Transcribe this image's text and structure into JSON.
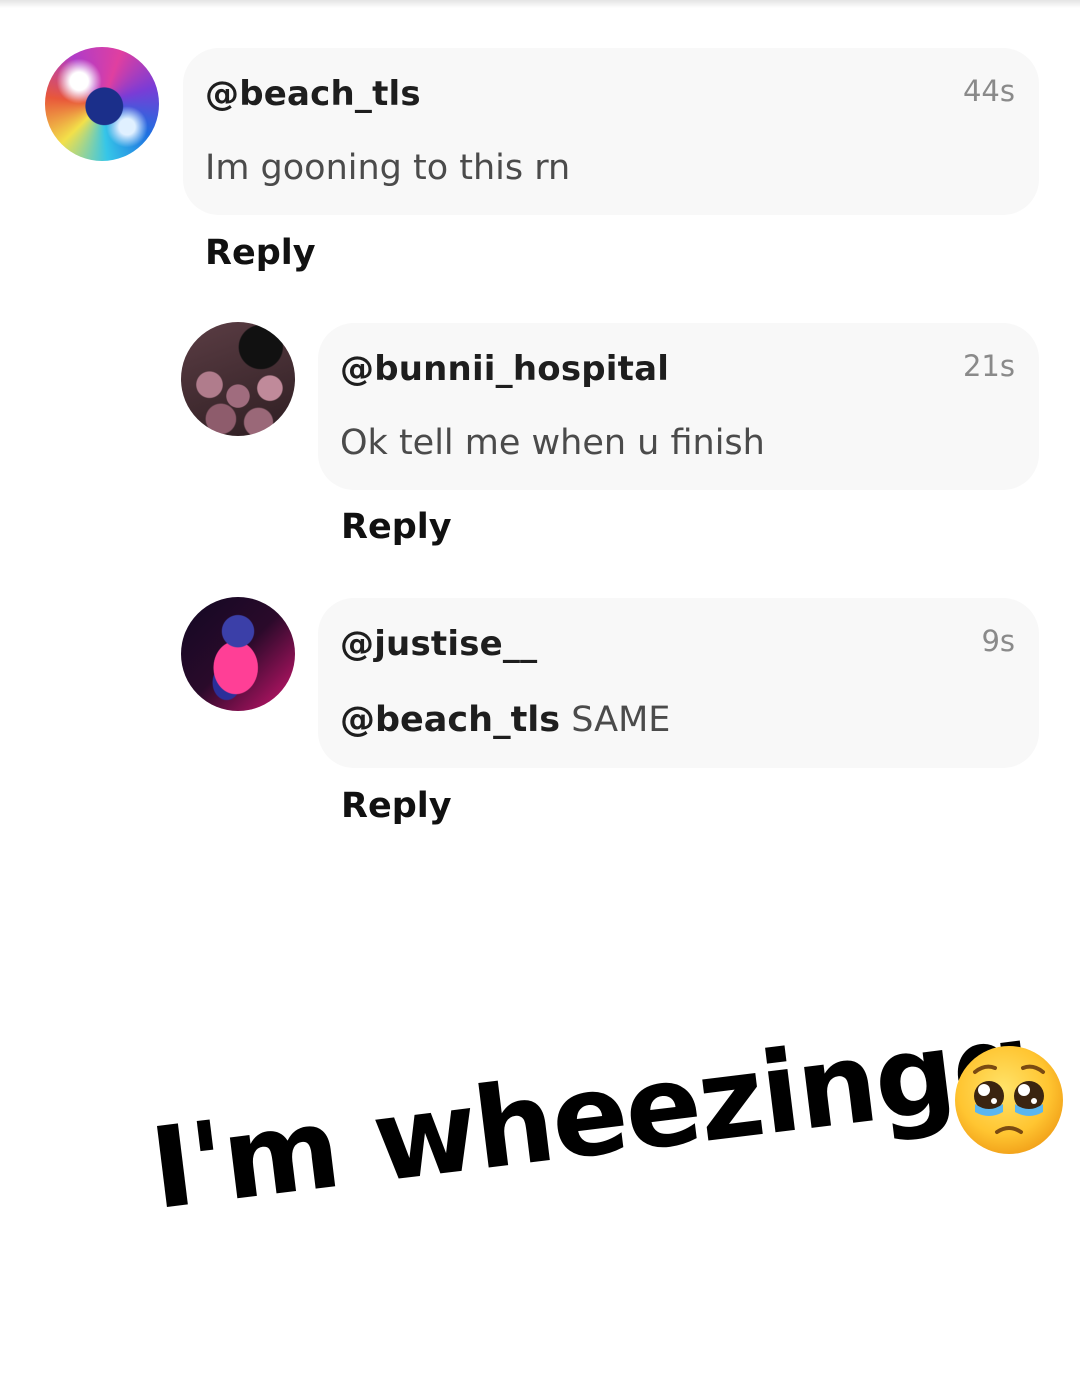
{
  "comments": [
    {
      "username": "@beach_tls",
      "time": "44s",
      "message": "Im gooning to this rn",
      "reply_label": "Reply"
    },
    {
      "username": "@bunnii_hospital",
      "time": "21s",
      "message": "Ok tell me when u finish",
      "reply_label": "Reply"
    },
    {
      "username": "@justise__",
      "time": "9s",
      "mention": "@beach_tls",
      "message": "SAME",
      "reply_label": "Reply"
    }
  ],
  "caption": {
    "text": "I'm wheezingg",
    "emoji": "pleading-face-with-tears-emoji"
  }
}
